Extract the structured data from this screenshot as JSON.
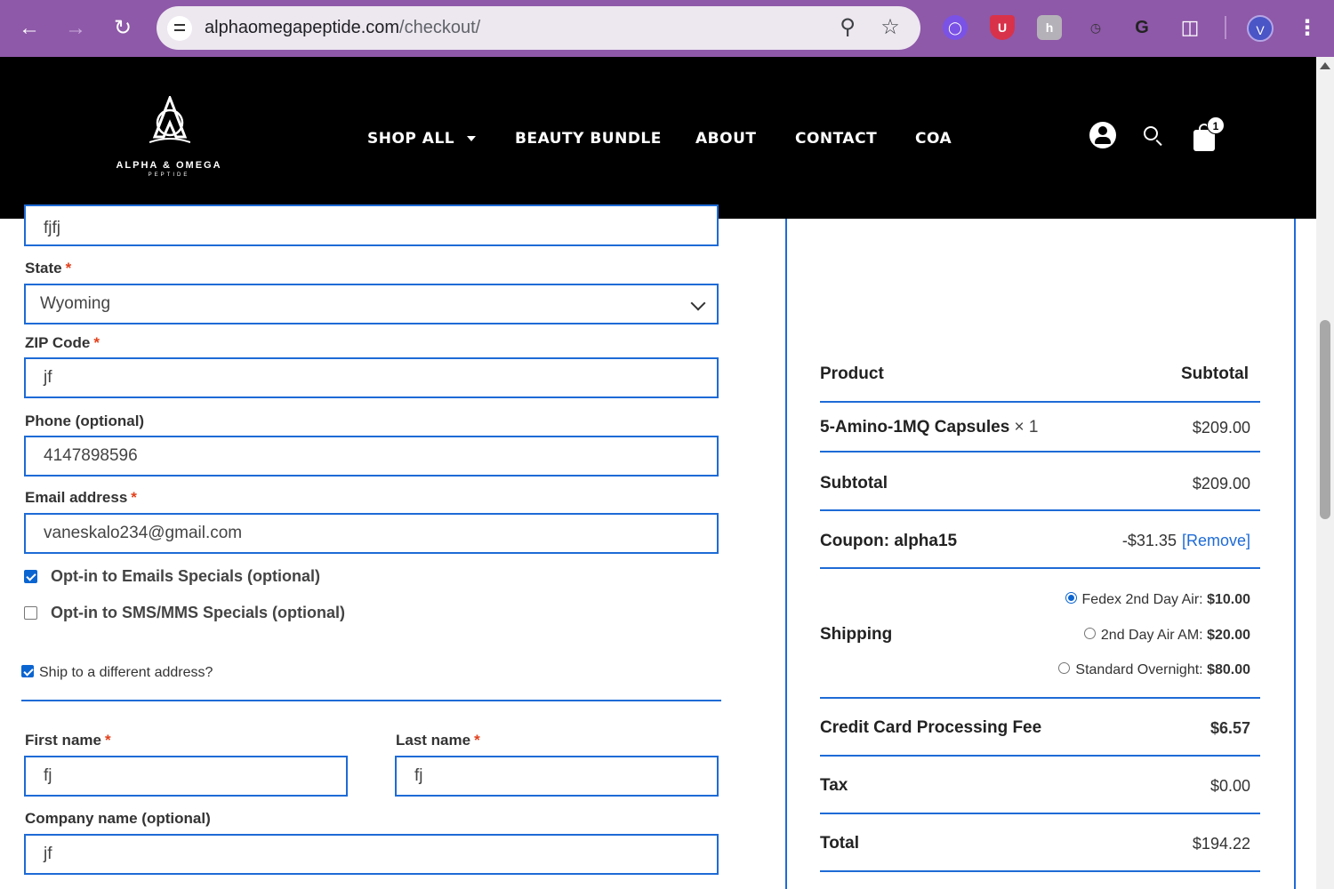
{
  "browser": {
    "url_host": "alphaomegapeptide.com",
    "url_path": "/checkout/",
    "profile_initial": "V",
    "extensions": [
      "link-extension-icon",
      "ublock-icon",
      "h-extension-icon",
      "timer-extension-icon",
      "grammarly-icon",
      "puzzle-extensions-icon"
    ]
  },
  "site": {
    "logo_text": "ALPHA & OMEGA",
    "logo_sub": "PEPTIDE",
    "nav": [
      "SHOP ALL",
      "BEAUTY BUNDLE",
      "ABOUT",
      "CONTACT",
      "COA"
    ],
    "cart_count": "1"
  },
  "form": {
    "city_value": "fjfj",
    "state_label": "State",
    "state_value": "Wyoming",
    "zip_label": "ZIP Code",
    "zip_value": "jf",
    "phone_label": "Phone (optional)",
    "phone_value": "4147898596",
    "email_label": "Email address",
    "email_value": "vaneskalo234@gmail.com",
    "optin_email_label": "Opt-in to Emails Specials (optional)",
    "optin_email_checked": true,
    "optin_sms_label": "Opt-in to SMS/MMS Specials (optional)",
    "optin_sms_checked": false,
    "ship_different_label": "Ship to a different address?",
    "ship_different_checked": true,
    "first_name_label": "First name",
    "first_name_value": "fj",
    "last_name_label": "Last name",
    "last_name_value": "fj",
    "company_label": "Company name (optional)",
    "company_value": "jf",
    "required_mark": "*"
  },
  "order": {
    "col_product": "Product",
    "col_subtotal": "Subtotal",
    "item_name": "5-Amino-1MQ Capsules",
    "item_qty": "× 1",
    "item_price": "$209.00",
    "subtotal_label": "Subtotal",
    "subtotal_value": "$209.00",
    "coupon_label": "Coupon: alpha15",
    "coupon_value": "-$31.35",
    "coupon_remove": "[Remove]",
    "shipping_label": "Shipping",
    "shipping_options": [
      {
        "label": "Fedex 2nd Day Air:",
        "price": "$10.00",
        "selected": true
      },
      {
        "label": "2nd Day Air AM:",
        "price": "$20.00",
        "selected": false
      },
      {
        "label": "Standard Overnight:",
        "price": "$80.00",
        "selected": false
      }
    ],
    "fee_label": "Credit Card Processing Fee",
    "fee_value": "$6.57",
    "tax_label": "Tax",
    "tax_value": "$0.00",
    "total_label": "Total",
    "total_value": "$194.22"
  },
  "colors": {
    "chrome": "#8e59a8",
    "accent": "#1e6bd6",
    "header_bg": "#000000",
    "required": "#e2401c"
  }
}
